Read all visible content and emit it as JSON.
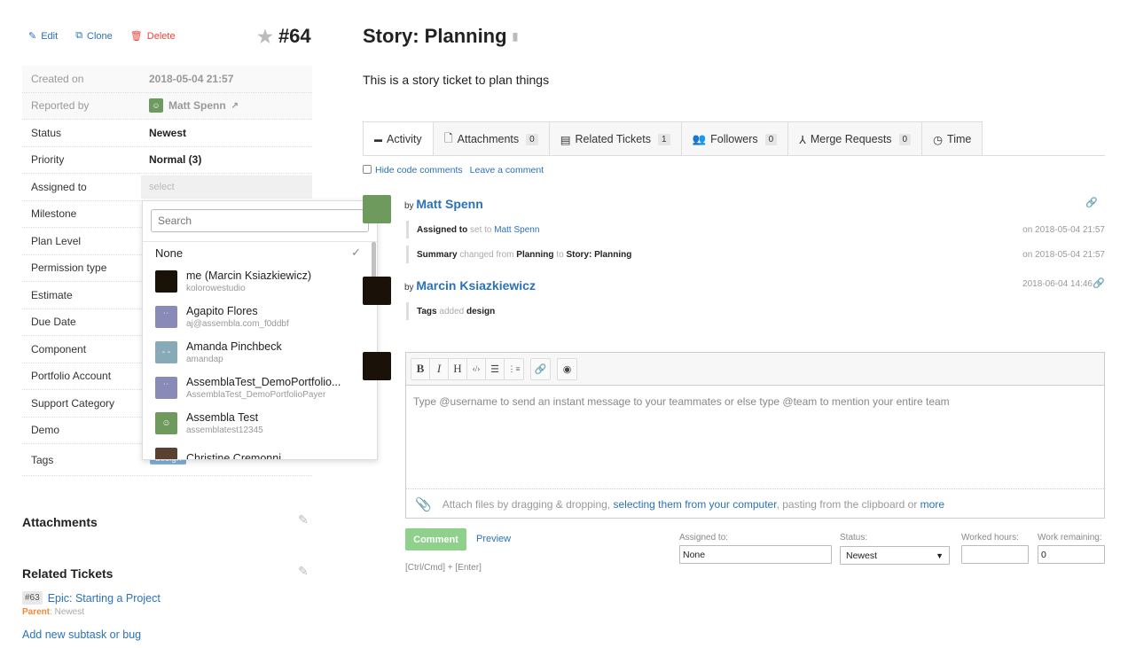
{
  "actions": {
    "edit": "Edit",
    "clone": "Clone",
    "delete": "Delete"
  },
  "ticket": {
    "number": "#64",
    "title": "Story: Planning",
    "description": "This is a story ticket to plan things"
  },
  "properties": [
    {
      "label": "Created on",
      "value": "2018-05-04 21:57"
    },
    {
      "label": "Reported by",
      "value": "Matt Spenn"
    },
    {
      "label": "Status",
      "value": "Newest"
    },
    {
      "label": "Priority",
      "value": "Normal (3)"
    },
    {
      "label": "Assigned to",
      "value": "select"
    },
    {
      "label": "Milestone",
      "value": ""
    },
    {
      "label": "Plan Level",
      "value": ""
    },
    {
      "label": "Permission type",
      "value": ""
    },
    {
      "label": "Estimate",
      "value": ""
    },
    {
      "label": "Due Date",
      "value": ""
    },
    {
      "label": "Component",
      "value": ""
    },
    {
      "label": "Portfolio Account",
      "value": ""
    },
    {
      "label": "Support Category",
      "value": ""
    },
    {
      "label": "Demo",
      "value": ""
    },
    {
      "label": "Tags",
      "value": "design"
    }
  ],
  "dropdown": {
    "search_placeholder": "Search",
    "none_label": "None",
    "items": [
      {
        "name": "me (Marcin Ksiazkiewicz)",
        "sub": "kolorowestudio",
        "color": "#1a1208"
      },
      {
        "name": "Agapito Flores",
        "sub": "aj@assembla.com_f0ddbf",
        "color": "#8a8ab8"
      },
      {
        "name": "Amanda Pinchbeck",
        "sub": "amandap",
        "color": "#88aab8"
      },
      {
        "name": "AssemblaTest_DemoPortfolio...",
        "sub": "AssemblaTest_DemoPortfolioPayer",
        "color": "#8a8ab8"
      },
      {
        "name": "Assembla Test",
        "sub": "assemblatest12345",
        "color": "#6e9a5e"
      },
      {
        "name": "Christine Cremonni",
        "sub": "",
        "color": "#5a4030"
      }
    ]
  },
  "sections": {
    "attachments": "Attachments",
    "related": "Related Tickets"
  },
  "related": {
    "num": "#63",
    "title": "Epic: Starting a Project",
    "rel": "Parent",
    "status": ": Newest",
    "add": "Add new subtask or bug"
  },
  "tabs": [
    {
      "label": "Activity"
    },
    {
      "label": "Attachments",
      "count": "0"
    },
    {
      "label": "Related Tickets",
      "count": "1"
    },
    {
      "label": "Followers",
      "count": "0"
    },
    {
      "label": "Merge Requests",
      "count": "0"
    },
    {
      "label": "Time"
    }
  ],
  "activity_opts": {
    "hide": "Hide code comments",
    "leave": "Leave a comment"
  },
  "activity": [
    {
      "by": "by",
      "author": "Matt Spenn",
      "changes": [
        {
          "field": "Assigned to",
          "verb": "set to",
          "to": "Matt Spenn",
          "date": "on 2018-05-04 21:57"
        },
        {
          "field": "Summary",
          "verb": "changed from",
          "from": "Planning",
          "mid": "to",
          "to": "Story: Planning",
          "date": "on 2018-05-04 21:57"
        }
      ]
    },
    {
      "by": "by",
      "author": "Marcin Ksiazkiewicz",
      "date": "2018-06-04 14:46",
      "changes": [
        {
          "field": "Tags",
          "verb": "added",
          "to": "design"
        }
      ]
    }
  ],
  "editor": {
    "placeholder": "Type @username to send an instant message to your teammates or else type @team to mention your entire team",
    "attach1": "Attach files by dragging & dropping, ",
    "attach_link": "selecting them from your computer",
    "attach2": ", pasting from the clipboard or ",
    "more": "more"
  },
  "form": {
    "comment": "Comment",
    "preview": "Preview",
    "shortcut": "[Ctrl/Cmd] + [Enter]",
    "assigned_label": "Assigned to:",
    "assigned_value": "None",
    "status_label": "Status:",
    "status_value": "Newest",
    "worked_label": "Worked hours:",
    "worked_value": "",
    "remaining_label": "Work remaining:",
    "remaining_value": "0"
  },
  "colors": {
    "link": "#2a72b8",
    "delete": "#e8473b",
    "comment_button": "#8fd18b",
    "parent": "#f08a3a"
  }
}
